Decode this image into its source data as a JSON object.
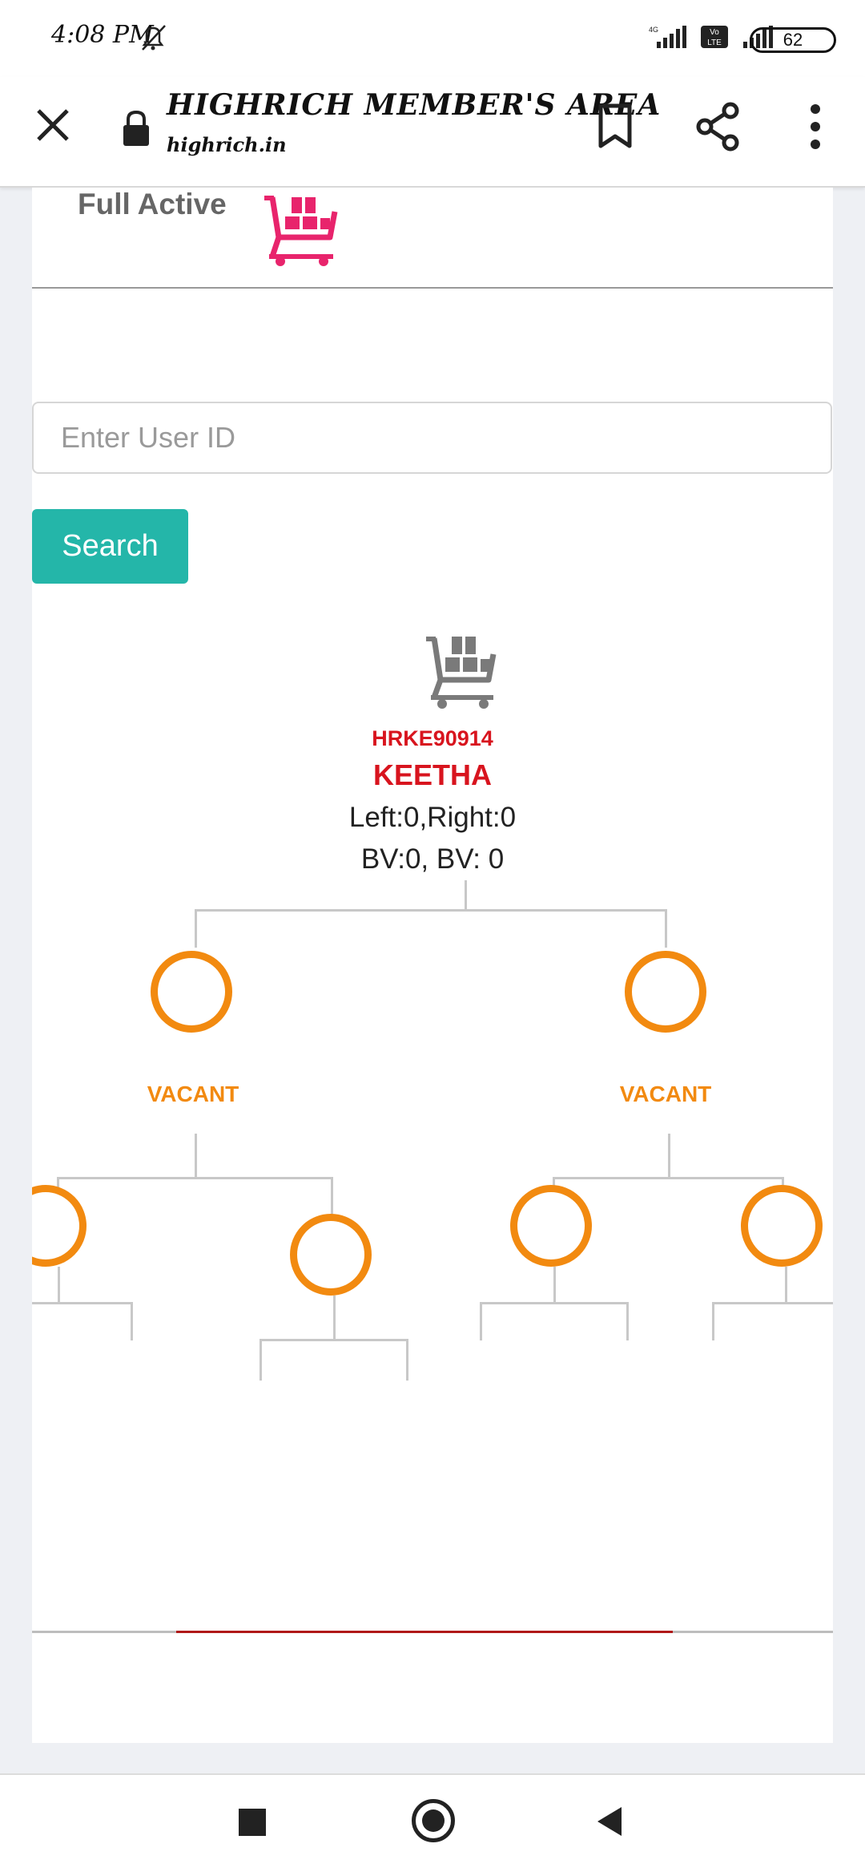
{
  "status_bar": {
    "time": "4:08 PM",
    "battery": "62",
    "network_label": "4G",
    "volte_label": "Vo LTE"
  },
  "browser": {
    "title": "HIGHRICH MEMBER'S AREA",
    "domain": "highrich.in"
  },
  "page": {
    "status_label": "Full Active",
    "search": {
      "placeholder": "Enter User ID",
      "value": "",
      "button_label": "Search"
    }
  },
  "tree": {
    "root": {
      "id": "HRKE90914",
      "name": "KEETHA",
      "left_right": "Left:0,Right:0",
      "bv": "BV:0, BV: 0"
    },
    "level1": [
      {
        "label": "VACANT"
      },
      {
        "label": "VACANT"
      }
    ],
    "level2_count": 4
  },
  "progress": {
    "fraction_start": 0.18,
    "fraction_end": 0.8
  },
  "colors": {
    "accent_teal": "#24b6a9",
    "root_red": "#d8141e",
    "vacant_orange": "#f28a10",
    "cart_pink": "#e8246c",
    "cart_gray": "#7a7a7a"
  },
  "icons": {
    "close": "close-icon",
    "lock": "lock-icon",
    "bookmark": "bookmark-icon",
    "share": "share-icon",
    "menu": "more-vert-icon",
    "cart": "gift-cart-icon"
  }
}
